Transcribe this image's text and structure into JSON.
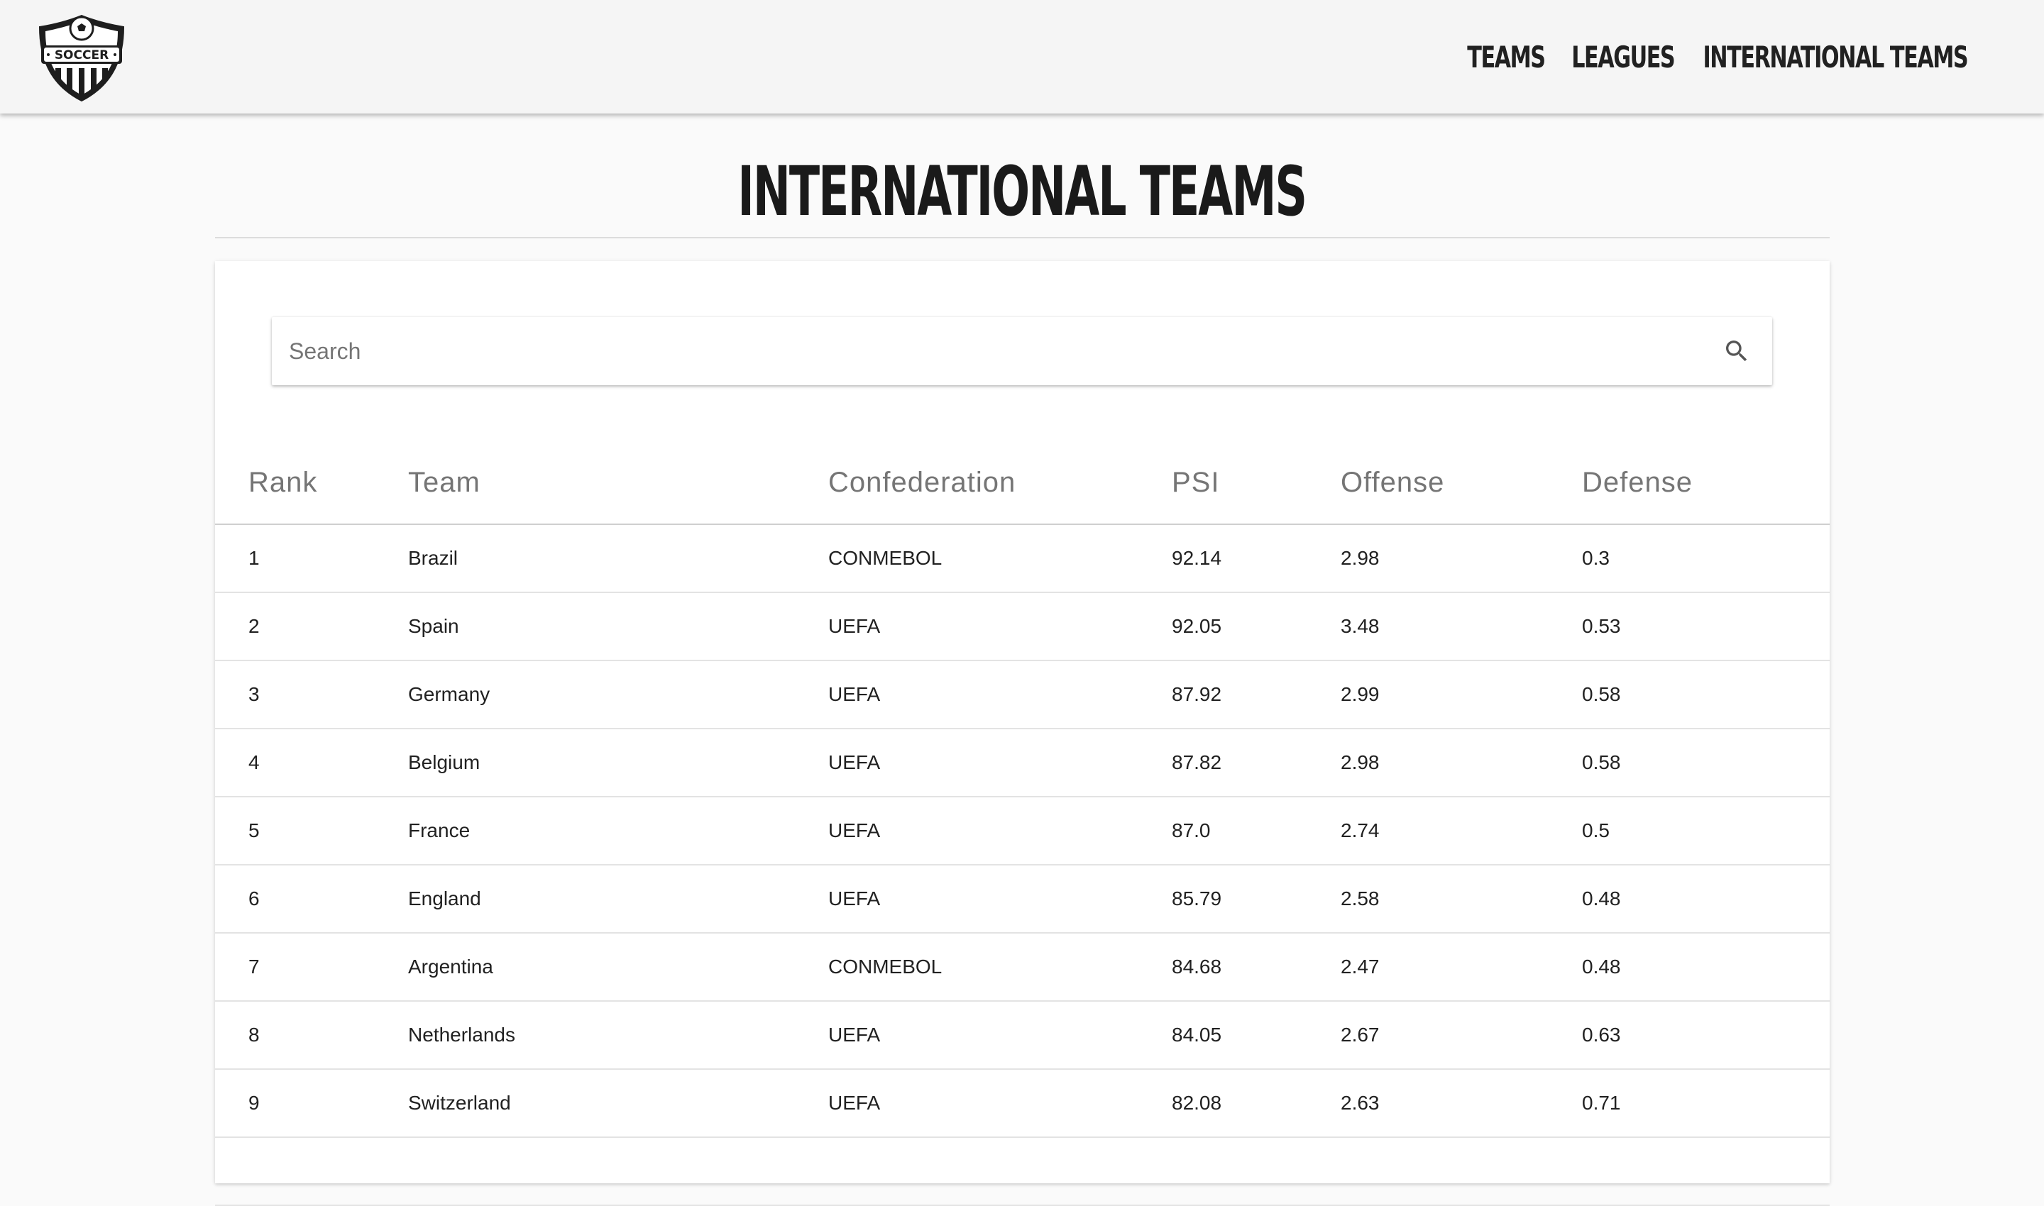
{
  "nav": {
    "logo_text": "SOCCER",
    "links": [
      "TEAMS",
      "LEAGUES",
      "INTERNATIONAL TEAMS"
    ]
  },
  "page": {
    "title": "INTERNATIONAL TEAMS"
  },
  "search": {
    "placeholder": "Search",
    "value": "",
    "icon": "search-icon"
  },
  "table": {
    "headers": [
      "Rank",
      "Team",
      "Confederation",
      "PSI",
      "Offense",
      "Defense"
    ],
    "rows": [
      [
        "1",
        "Brazil",
        "CONMEBOL",
        "92.14",
        "2.98",
        "0.3"
      ],
      [
        "2",
        "Spain",
        "UEFA",
        "92.05",
        "3.48",
        "0.53"
      ],
      [
        "3",
        "Germany",
        "UEFA",
        "87.92",
        "2.99",
        "0.58"
      ],
      [
        "4",
        "Belgium",
        "UEFA",
        "87.82",
        "2.98",
        "0.58"
      ],
      [
        "5",
        "France",
        "UEFA",
        "87.0",
        "2.74",
        "0.5"
      ],
      [
        "6",
        "England",
        "UEFA",
        "85.79",
        "2.58",
        "0.48"
      ],
      [
        "7",
        "Argentina",
        "CONMEBOL",
        "84.68",
        "2.47",
        "0.48"
      ],
      [
        "8",
        "Netherlands",
        "UEFA",
        "84.05",
        "2.67",
        "0.63"
      ],
      [
        "9",
        "Switzerland",
        "UEFA",
        "82.08",
        "2.63",
        "0.71"
      ]
    ]
  },
  "colors": {
    "navbar_bg": "#f5f5f5",
    "page_bg": "#fafafa",
    "text": "#212121",
    "header_text": "#757575"
  }
}
